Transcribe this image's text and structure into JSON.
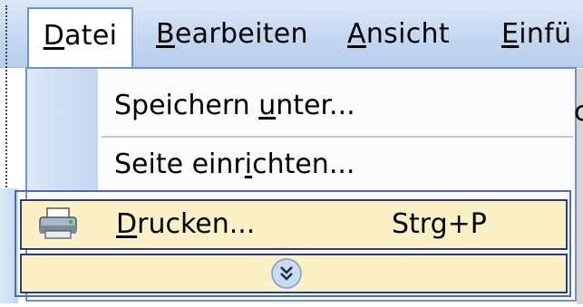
{
  "menubar": {
    "items": [
      {
        "label": "Datei",
        "mnemonic_index": 0
      },
      {
        "label": "Bearbeiten",
        "mnemonic_index": 0
      },
      {
        "label": "Ansicht",
        "mnemonic_index": 0
      },
      {
        "label": "Einfü",
        "mnemonic_index": 0
      }
    ]
  },
  "dropdown": {
    "items": [
      {
        "label_pre": "Speichern ",
        "label_u": "u",
        "label_post": "nter..."
      },
      {
        "label_pre": "Seite einr",
        "label_u": "i",
        "label_post": "chten..."
      }
    ],
    "print": {
      "label_pre": "",
      "label_u": "D",
      "label_post": "rucken...",
      "shortcut": "Strg+P",
      "icon": "printer-icon"
    },
    "expand": {
      "icon": "chevron-double-down-icon"
    }
  },
  "colors": {
    "menubar": "#c5d8f1",
    "highlight": "#fbf0c6",
    "border": "#6f93c9"
  }
}
